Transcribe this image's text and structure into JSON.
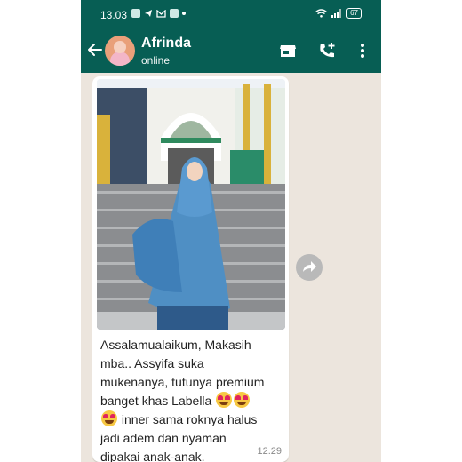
{
  "status_bar": {
    "time": "13.03",
    "battery": "67"
  },
  "chat_header": {
    "contact_name": "Afrinda",
    "presence": "online"
  },
  "message": {
    "lines": [
      "Assalamualaikum, Makasih",
      "mba.. Assyifa suka",
      "mukenanya, tutunya premium",
      "banget khas Labella",
      "inner sama roknya halus",
      "jadi adem dan nyaman",
      "dipakai anak-anak."
    ],
    "time": "12.29"
  },
  "colors": {
    "header": "#075e54",
    "chat_background": "#ece5dd",
    "bubble": "#ffffff",
    "emoji": "smiling-heart-eyes"
  },
  "icons": [
    "back-arrow-icon",
    "store-icon",
    "add-call-icon",
    "more-vert-icon",
    "forward-icon",
    "wifi-icon",
    "signal-icon",
    "battery-icon"
  ]
}
